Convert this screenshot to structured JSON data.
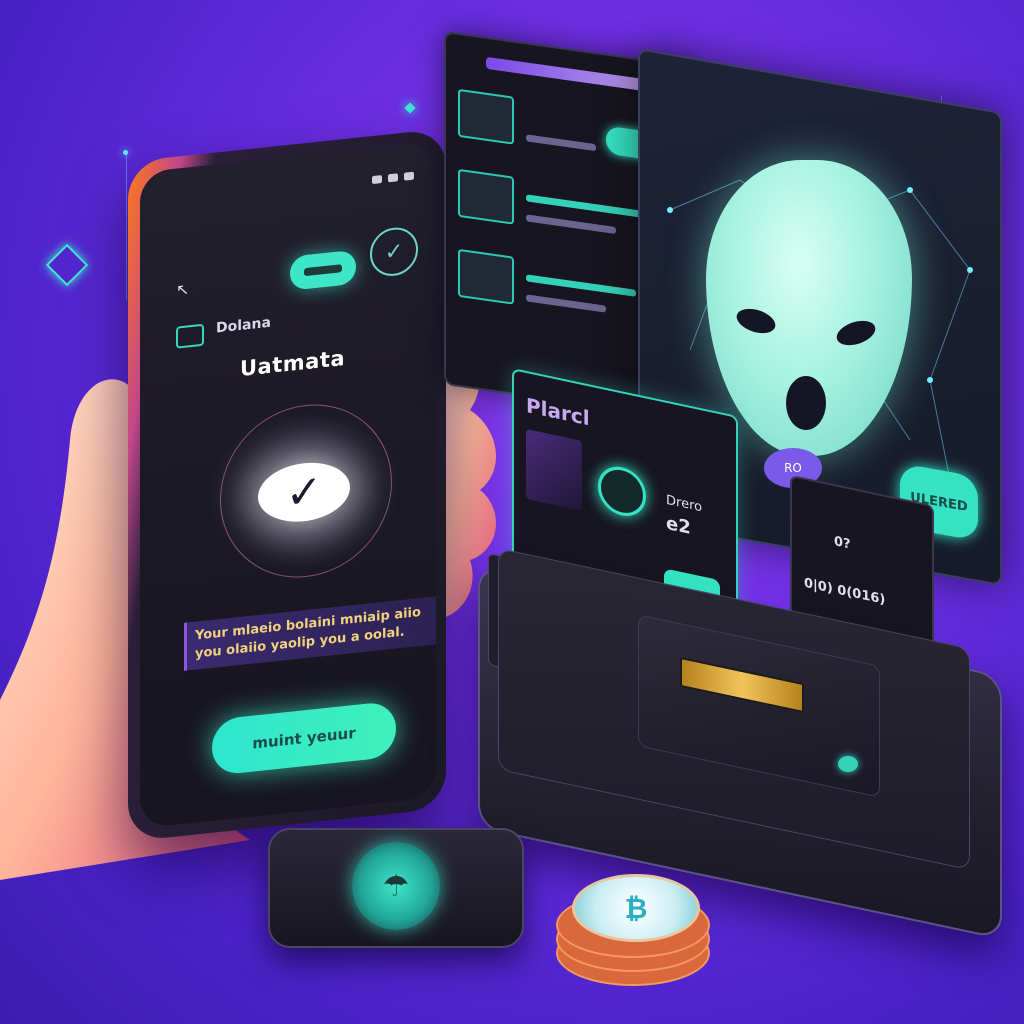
{
  "phone": {
    "app_name": "Dolana",
    "title": "Uatmata",
    "message": "Your mlaeio bolaini mniaip aiio you olaiio yaolip you a oolal.",
    "cta_label": "muint yeuur"
  },
  "brand_card": {
    "label": "Plarcl",
    "text_a": "Drero",
    "text_b": "e2"
  },
  "mask_panel": {
    "badge": "RO",
    "button_label": "ULERED"
  },
  "small_panel": {
    "text_a": "0?",
    "text_b": "0|0) 0(016)"
  },
  "colors": {
    "accent": "#35e2c4",
    "background": "#6a2de0",
    "gold": "#f2c45a"
  },
  "icons": [
    "back-arrow-icon",
    "checkmark-icon",
    "shield-icon",
    "coin-icon",
    "mask-icon"
  ]
}
